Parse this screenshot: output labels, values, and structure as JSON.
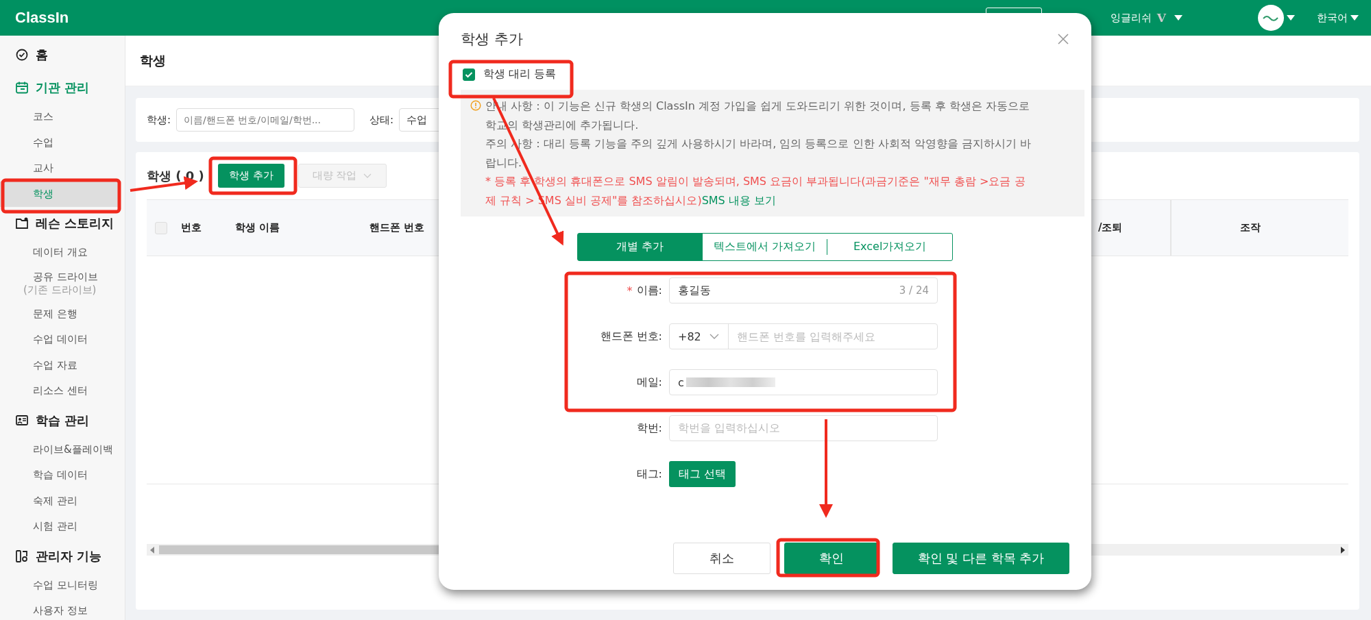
{
  "topbar": {
    "logo": "ClassIn",
    "org_name": "잉글리쉬",
    "org_mark": "V",
    "language": "한국어"
  },
  "sidebar": {
    "sections": [
      {
        "title": "홈",
        "active": false
      },
      {
        "title": "기관 관리",
        "active": true,
        "items": [
          {
            "label": "코스",
            "selected": false
          },
          {
            "label": "수업",
            "selected": false
          },
          {
            "label": "교사",
            "selected": false
          },
          {
            "label": "학생",
            "selected": true
          }
        ]
      },
      {
        "title": "레슨 스토리지",
        "active": false,
        "items": [
          {
            "label": "데이터 개요",
            "selected": false
          },
          {
            "label": "공유 드라이브",
            "note": "(기존 드라이브)",
            "selected": false
          },
          {
            "label": "문제 은행",
            "selected": false
          },
          {
            "label": "수업 데이터",
            "selected": false
          },
          {
            "label": "수업 자료",
            "selected": false
          },
          {
            "label": "리소스 센터",
            "selected": false
          }
        ]
      },
      {
        "title": "학습 관리",
        "active": false,
        "items": [
          {
            "label": "라이브&플레이백",
            "selected": false
          },
          {
            "label": "학습 데이터",
            "selected": false
          },
          {
            "label": "숙제 관리",
            "selected": false
          },
          {
            "label": "시험 관리",
            "selected": false
          }
        ]
      },
      {
        "title": "관리자 기능",
        "active": false,
        "items": [
          {
            "label": "수업 모니터링",
            "selected": false
          },
          {
            "label": "사용자 정보",
            "selected": false
          }
        ]
      }
    ]
  },
  "page": {
    "title": "학생",
    "filters": [
      {
        "label": "학생:",
        "placeholder": "이름/핸드폰 번호/이메일/학번..."
      },
      {
        "label": "상태:",
        "value": "수업"
      }
    ],
    "table": {
      "title": "학생 ( 0 )",
      "select_all": {
        "checked": false
      },
      "buttons": [
        {
          "label": "학생 추가",
          "disabled": false
        },
        {
          "label": "대량 작업",
          "disabled": true
        }
      ],
      "columns": [
        "번호",
        "학생 이름",
        "핸드폰 번호",
        "/조퇴",
        "조작"
      ]
    }
  },
  "dialog": {
    "title": "학생 추가",
    "proxy": {
      "label": "학생 대리 등록",
      "checked": true
    },
    "notice": {
      "info": "안내 사항 : 이 기능은 신규 학생의 ClassIn 계정 가입을 쉽게 도와드리기 위한 것이며, 등록 후 학생은 자동으로 학교의 학생관리에 추가됩니다.",
      "caution": "주의 사항 : 대리 등록 기능을 주의 깊게 사용하시기 바라며, 임의 등록으로 인한 사회적 악영향을 금지하시기 바랍니다.",
      "fee": "* 등록 후 학생의 휴대폰으로 SMS 알림이 발송되며, SMS 요금이 부과됩니다(과금기준은 \"재무 총람 >요금 공제 규칙 > SMS 실비 공제\"를 참조하십시오)",
      "link": "SMS 내용 보기"
    },
    "tabs": [
      {
        "label": "개별 추가",
        "selected": true
      },
      {
        "label": "텍스트에서 가져오기",
        "selected": false
      },
      {
        "label": "Excel가져오기",
        "selected": false
      }
    ],
    "fields": [
      {
        "kind": "text",
        "required_mark": "*",
        "label": "이름:",
        "value": "홍길동",
        "counter": "3 / 24"
      },
      {
        "kind": "phone",
        "label": "핸드폰 번호:",
        "code": "+82",
        "placeholder": "핸드폰 번호를 입력해주세요"
      },
      {
        "kind": "text",
        "label": "메일:",
        "value": "c",
        "redacted": true
      },
      {
        "kind": "text",
        "label": "학번:",
        "placeholder": "학번을 입력하십시오"
      },
      {
        "kind": "button",
        "label": "태그:",
        "button": "태그 선택"
      }
    ],
    "buttons": [
      {
        "label": "취소",
        "primary": false
      },
      {
        "label": "확인",
        "primary": true
      },
      {
        "label": "확인 및 다른 학목 추가",
        "primary": true
      }
    ]
  }
}
